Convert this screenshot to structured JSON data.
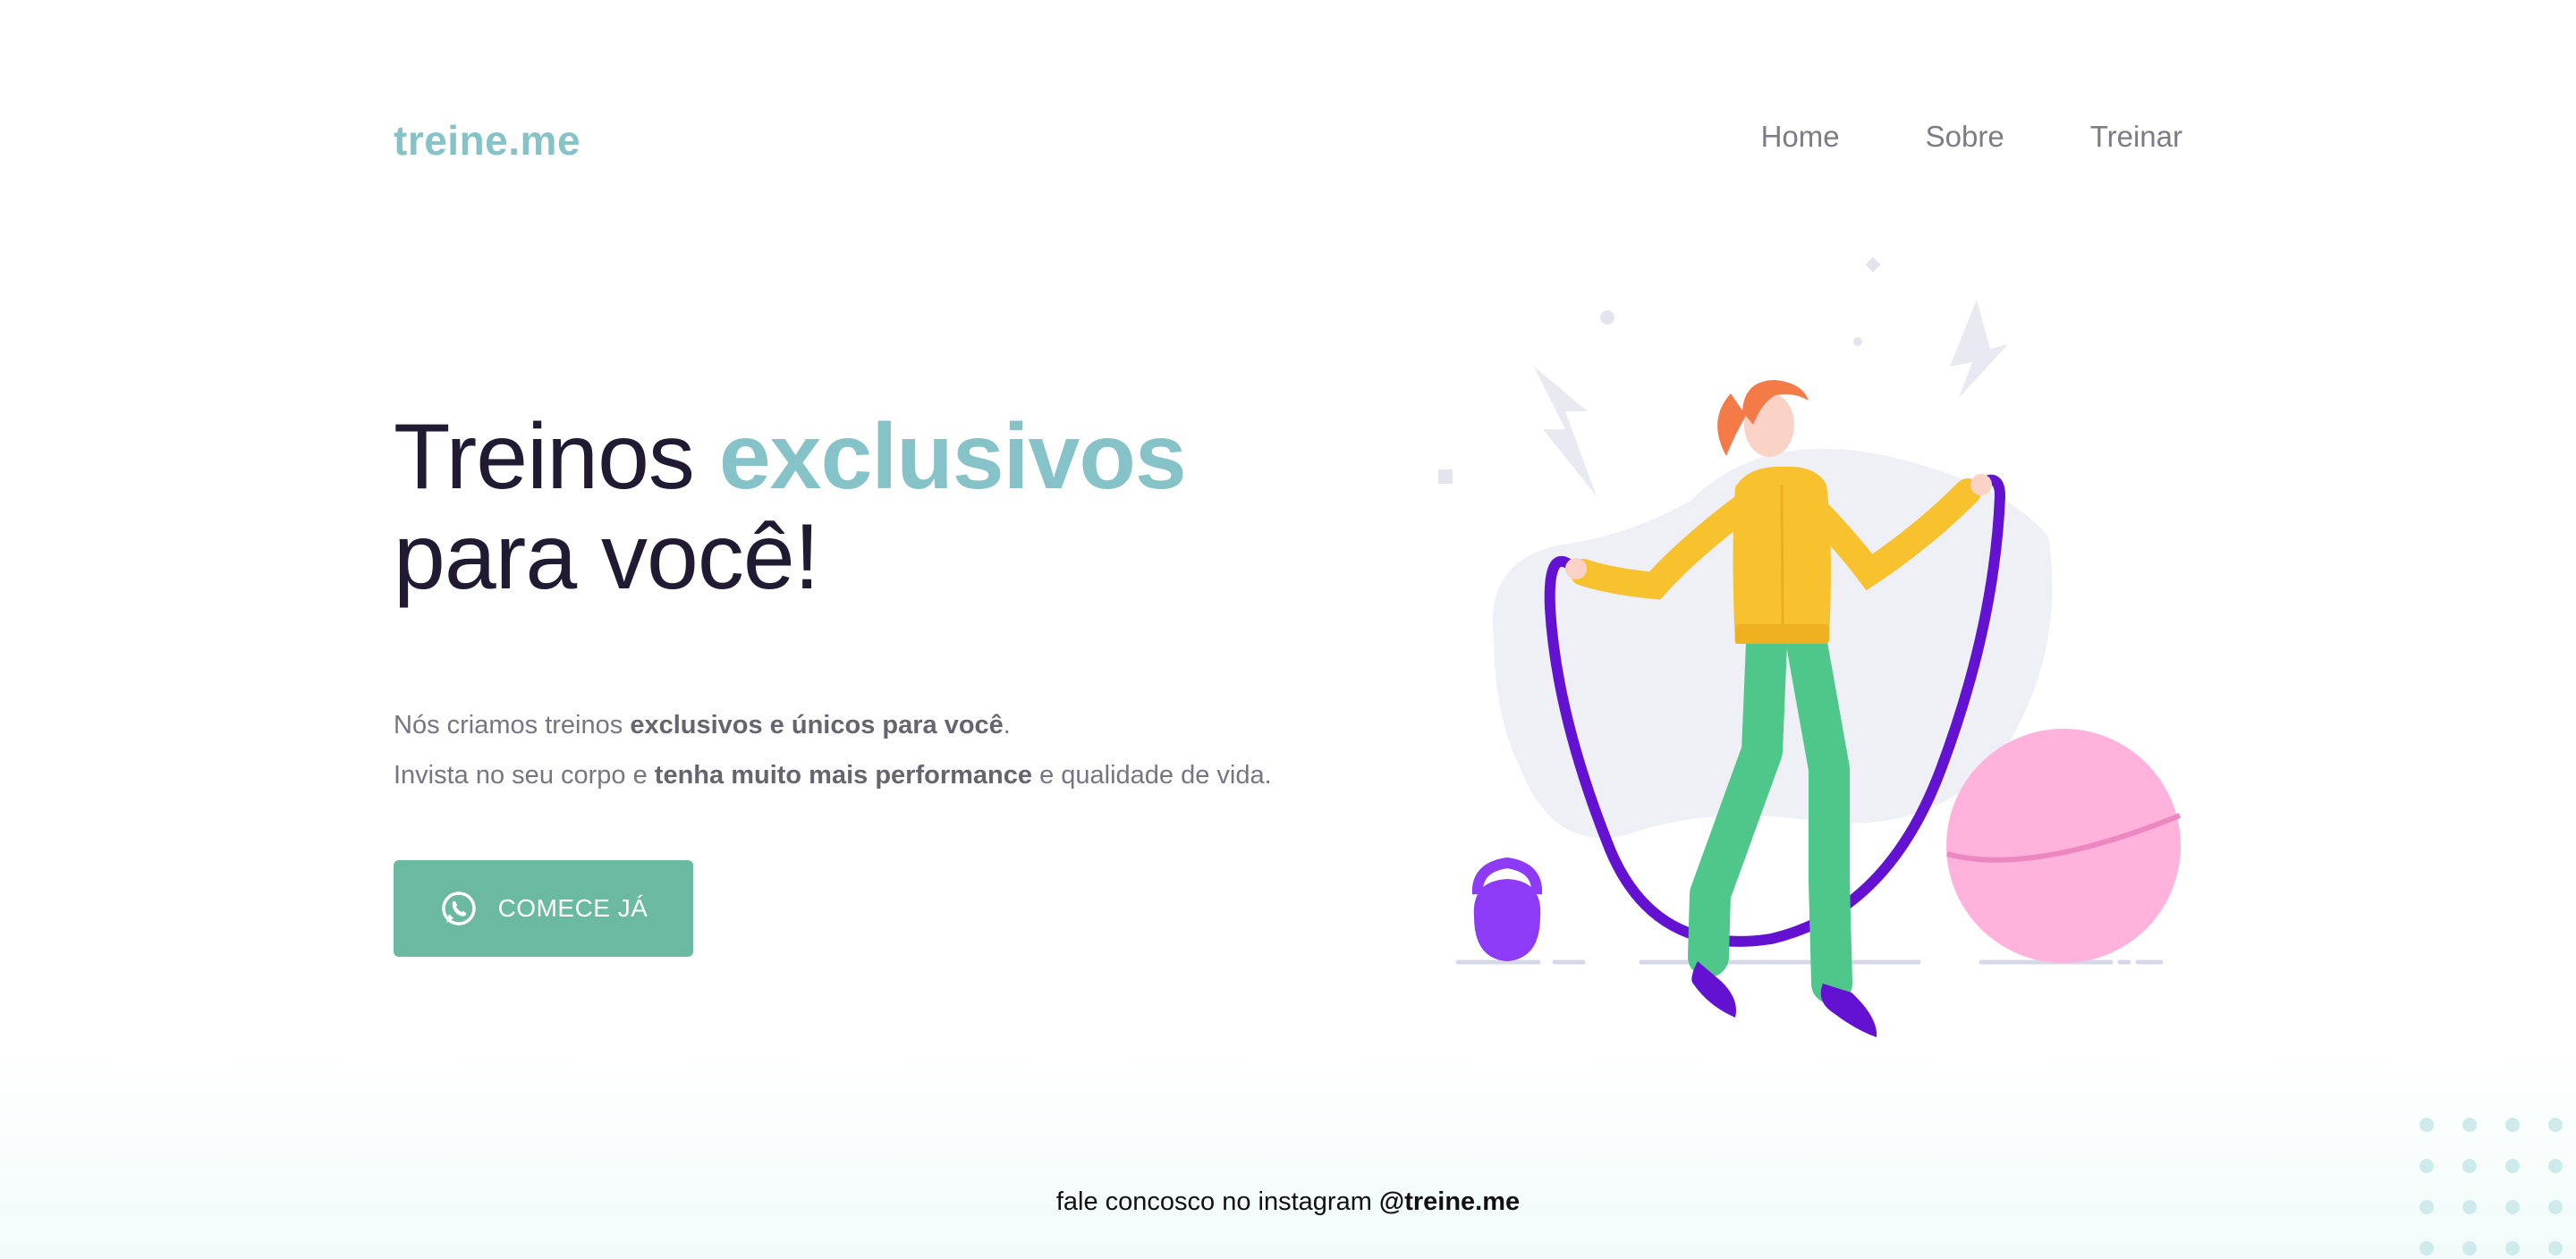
{
  "brand": {
    "logo_text": "treine.me",
    "accent_color": "#86c3c8",
    "cta_color": "#6ab9a0"
  },
  "nav": {
    "items": [
      {
        "label": "Home"
      },
      {
        "label": "Sobre"
      },
      {
        "label": "Treinar"
      }
    ]
  },
  "hero": {
    "title_part1": "Treinos ",
    "title_accent": "exclusivos",
    "title_line2": "para você!",
    "desc_line1_start": "Nós criamos treinos ",
    "desc_line1_bold": "exclusivos e únicos para você",
    "desc_line1_end": ".",
    "desc_line2_start": "Invista no seu corpo e ",
    "desc_line2_bold": "tenha muito mais performance",
    "desc_line2_end": " e qualidade de vida."
  },
  "cta": {
    "label": "COMECE JÁ",
    "icon": "whatsapp-icon"
  },
  "illustration": {
    "subject": "woman-jumping-rope-illustration"
  },
  "footer": {
    "text": "fale concosco no instagram ",
    "handle": "@treine.me"
  }
}
